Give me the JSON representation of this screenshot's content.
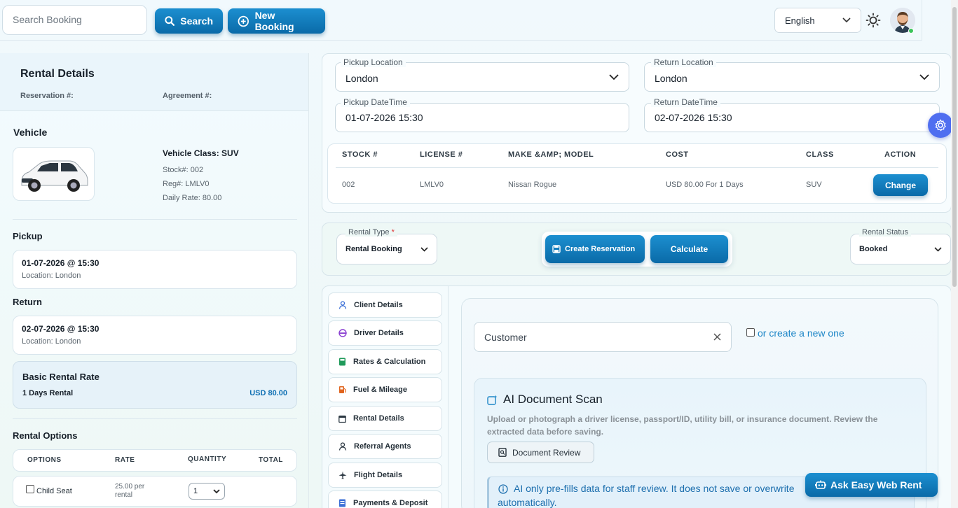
{
  "header": {
    "search_placeholder": "Search Booking",
    "search_button": "Search",
    "new_booking_button": "New Booking",
    "language": "English"
  },
  "rental_details": {
    "title": "Rental Details",
    "reservation_label": "Reservation #:",
    "agreement_label": "Agreement #:"
  },
  "vehicle": {
    "title": "Vehicle",
    "class": "Vehicle Class: SUV",
    "stock": "Stock#: 002",
    "reg": "Reg#: LMLV0",
    "daily_rate": "Daily Rate: 80.00"
  },
  "pickup": {
    "title": "Pickup",
    "datetime": "01-07-2026 @ 15:30",
    "location": "Location: London"
  },
  "return": {
    "title": "Return",
    "datetime": "02-07-2026 @ 15:30",
    "location": "Location: London"
  },
  "basic_rate": {
    "title": "Basic Rental Rate",
    "duration": "1 Days Rental",
    "amount": "USD 80.00"
  },
  "rental_options": {
    "title": "Rental Options",
    "columns": [
      "OPTIONS",
      "RATE",
      "QUANTITY",
      "TOTAL"
    ],
    "rows": [
      {
        "option": "Child Seat",
        "rate": "25.00 per rental",
        "quantity": "1",
        "total": ""
      }
    ]
  },
  "locations": {
    "pickup_location_label": "Pickup Location",
    "pickup_location": "London",
    "return_location_label": "Return Location",
    "return_location": "London",
    "pickup_datetime_label": "Pickup DateTime",
    "pickup_datetime": "01-07-2026 15:30",
    "return_datetime_label": "Return DateTime",
    "return_datetime": "02-07-2026 15:30"
  },
  "vehicle_table": {
    "columns": [
      "STOCK #",
      "LICENSE #",
      "MAKE &AMP; MODEL",
      "COST",
      "CLASS",
      "ACTION"
    ],
    "rows": [
      {
        "stock": "002",
        "license": "LMLV0",
        "model": "Nissan Rogue",
        "cost": "USD 80.00 For 1 Days",
        "class": "SUV",
        "action": "Change"
      }
    ]
  },
  "booking": {
    "rental_type_label": "Rental Type",
    "required_mark": "*",
    "rental_type": "Rental Booking",
    "create_button": "Create Reservation",
    "calculate_button": "Calculate",
    "rental_status_label": "Rental Status",
    "rental_status": "Booked"
  },
  "tabs": [
    {
      "label": "Client Details",
      "icon": "user-icon",
      "color": "#3b6fd6"
    },
    {
      "label": "Driver Details",
      "icon": "driver-icon",
      "color": "#8a3fd1"
    },
    {
      "label": "Rates & Calculation",
      "icon": "calculator-icon",
      "color": "#1f9a5a"
    },
    {
      "label": "Fuel & Mileage",
      "icon": "fuel-icon",
      "color": "#e0641e"
    },
    {
      "label": "Rental Details",
      "icon": "calendar-icon",
      "color": "#2e3a44"
    },
    {
      "label": "Referral Agents",
      "icon": "agent-icon",
      "color": "#2e3a44"
    },
    {
      "label": "Flight Details",
      "icon": "plane-icon",
      "color": "#2e3a44"
    },
    {
      "label": "Payments & Deposit",
      "icon": "payment-icon",
      "color": "#3b6fd6"
    }
  ],
  "client": {
    "customer_value": "Customer",
    "create_new": "or create a new one"
  },
  "ai_scan": {
    "title": "AI Document Scan",
    "description": "Upload or photograph a driver license, passport/ID, utility bill, or insurance document. Review the extracted data before saving.",
    "review_button": "Document Review",
    "notice_line1": "AI only pre-fills data for staff review. It does not save or overwrite",
    "notice_line2": "automatically."
  },
  "ask_button": "Ask Easy Web Rent",
  "colors": {
    "accent": "#0e78bb",
    "accent_dark": "#0a6aa8",
    "status_online": "#3bc45a",
    "required": "#e03131"
  }
}
